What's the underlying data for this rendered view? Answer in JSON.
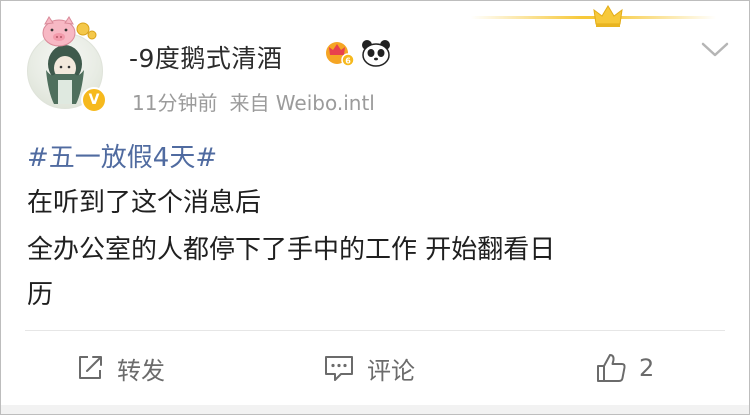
{
  "post": {
    "author": {
      "name": "-9度鹅式清酒",
      "verified_badge": "V",
      "vip_icon": "vip-crown-icon",
      "panda_icon": "panda-icon"
    },
    "meta": {
      "time": "11分钟前",
      "source": "来自 Weibo.intl"
    },
    "hashtag": "#五一放假4天#",
    "body_lines": [
      "在听到了这个消息后",
      "全办公室的人都停下了手中的工作 开始翻看日",
      "历"
    ]
  },
  "actions": {
    "repost_label": "转发",
    "comment_label": "评论",
    "like_count": "2"
  },
  "colors": {
    "hashtag": "#506ba0",
    "badge": "#f6b91d",
    "crown": "#f7c93a",
    "meta_text": "#9b9b9b",
    "action_text": "#6b6b6b"
  }
}
